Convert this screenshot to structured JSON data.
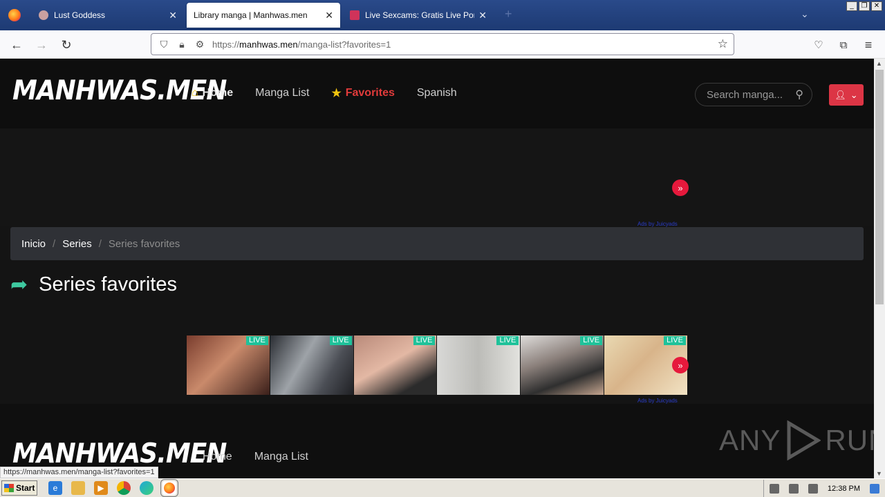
{
  "browser": {
    "tabs": [
      {
        "label": "Lust Goddess",
        "active": false
      },
      {
        "label": "Library manga | Manhwas.men",
        "active": true
      },
      {
        "label": "Live Sexcams: Gratis Live Porn Cha",
        "active": false
      }
    ],
    "url_prefix": "https://",
    "url_host": "manhwas.men",
    "url_path": "/manga-list?favorites=1",
    "status_url": "https://manhwas.men/manga-list?favorites=1"
  },
  "site": {
    "logo": "MANHWAS.MEN",
    "menu": {
      "home": "Home",
      "manga_list": "Manga List",
      "favorites": "Favorites",
      "spanish": "Spanish"
    },
    "search_placeholder": "Search manga...",
    "accent": "#dc3545"
  },
  "ads": {
    "credit": "Ads by Juicyads",
    "live_badge": "LIVE",
    "cam_count": 6
  },
  "breadcrumb": {
    "items": [
      "Inicio",
      "Series"
    ],
    "current": "Series favorites"
  },
  "page_title": "Series favorites",
  "footer": {
    "logo": "MANHWAS.MEN",
    "links": [
      "Home",
      "Manga List"
    ],
    "watermark_left": "ANY",
    "watermark_right": "RUN"
  },
  "taskbar": {
    "start_label": "Start",
    "clock": "12:38 PM"
  }
}
